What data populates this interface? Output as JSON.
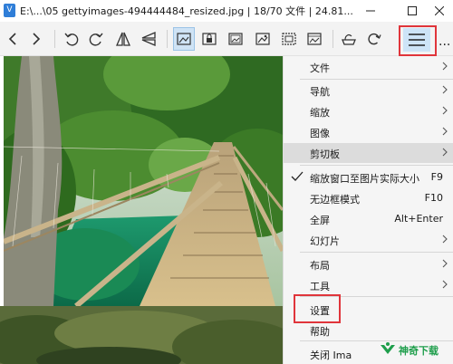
{
  "window": {
    "app_icon_letter": "V",
    "title": "E:\\...\\05 gettyimages-494444484_resized.jpg  |  18/70 文件  |  24.81..."
  },
  "toolbar": {
    "buttons": [
      {
        "name": "previous",
        "icon": "chevron-left-icon"
      },
      {
        "name": "next",
        "icon": "chevron-right-icon"
      },
      {
        "name": "rotate-left",
        "icon": "rotate-left-icon"
      },
      {
        "name": "rotate-right",
        "icon": "rotate-right-icon"
      },
      {
        "name": "flip-horizontal",
        "icon": "flip-horizontal-icon"
      },
      {
        "name": "flip-vertical",
        "icon": "flip-vertical-icon"
      },
      {
        "name": "fit-image",
        "icon": "image-fit-icon"
      },
      {
        "name": "lock-zoom",
        "icon": "image-lock-icon"
      },
      {
        "name": "image-info",
        "icon": "image-info-icon"
      },
      {
        "name": "image-adjust",
        "icon": "image-adjust-icon"
      },
      {
        "name": "image-crop",
        "icon": "image-crop-icon"
      },
      {
        "name": "image-gallery",
        "icon": "image-gallery-icon"
      },
      {
        "name": "paint",
        "icon": "paint-bucket-icon"
      },
      {
        "name": "refresh",
        "icon": "refresh-icon"
      },
      {
        "name": "main-menu",
        "icon": "hamburger-menu-icon"
      },
      {
        "name": "more",
        "icon": "more-icon",
        "label": "..."
      }
    ]
  },
  "menu": {
    "items": [
      {
        "label": "文件",
        "has_submenu": true
      },
      {
        "label": "导航",
        "has_submenu": true
      },
      {
        "label": "缩放",
        "has_submenu": true
      },
      {
        "label": "图像",
        "has_submenu": true
      },
      {
        "label": "剪切板",
        "has_submenu": true,
        "hovered": true
      },
      {
        "label": "缩放窗口至图片实际大小",
        "shortcut": "F9",
        "checked": true
      },
      {
        "label": "无边框模式",
        "shortcut": "F10"
      },
      {
        "label": "全屏",
        "shortcut": "Alt+Enter"
      },
      {
        "label": "幻灯片",
        "has_submenu": true
      },
      {
        "label": "布局",
        "has_submenu": true
      },
      {
        "label": "工具",
        "has_submenu": true
      },
      {
        "label": "设置"
      },
      {
        "label": "帮助"
      },
      {
        "label": "关闭 Ima"
      }
    ]
  },
  "watermark": {
    "text": "神奇下载"
  },
  "colors": {
    "highlight_box": "#e0353b",
    "menu_hover": "#dcdcdc",
    "toolbar_active": "#cde4f7",
    "app_icon": "#2f7ed8",
    "watermark": "#1e9e4b"
  }
}
